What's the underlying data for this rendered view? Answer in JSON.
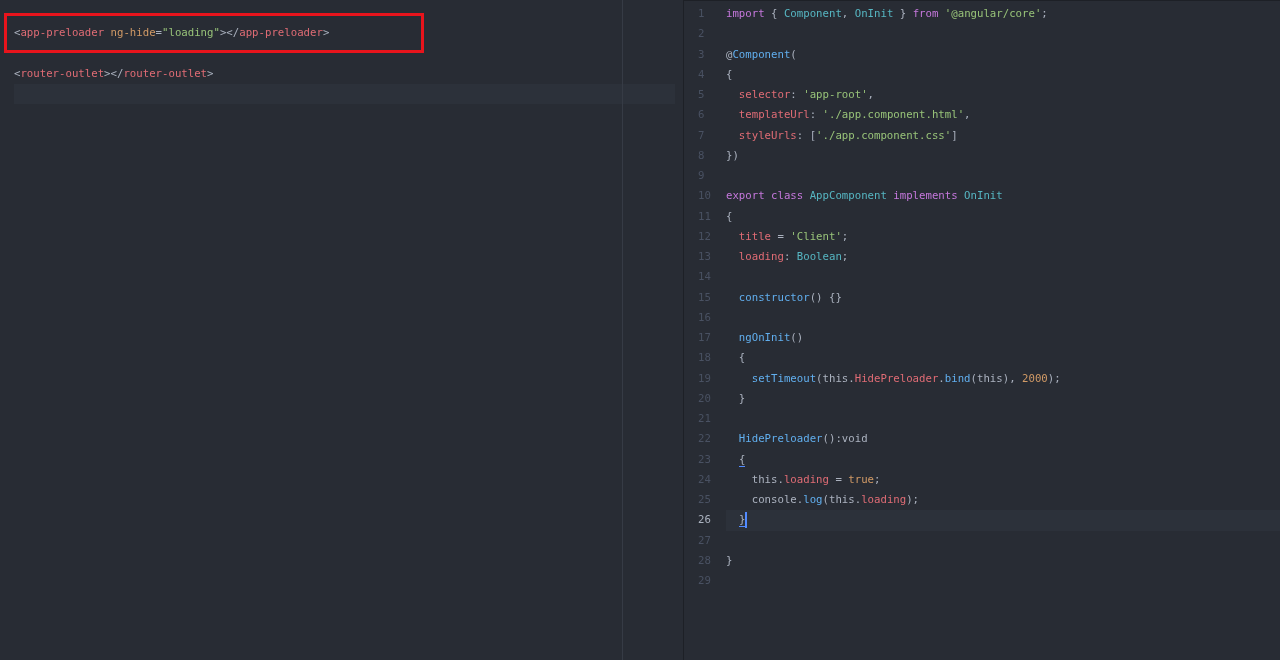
{
  "left_pane": {
    "lines": [
      {
        "boxed": true,
        "tokens": [
          {
            "text": "<",
            "kind": "punct"
          },
          {
            "text": "app-preloader",
            "kind": "tag"
          },
          {
            "text": " ng-hide",
            "kind": "attr"
          },
          {
            "text": "=",
            "kind": "punct"
          },
          {
            "text": "\"loading\"",
            "kind": "string"
          },
          {
            "text": "></",
            "kind": "punct"
          },
          {
            "text": "app-preloader",
            "kind": "tag"
          },
          {
            "text": ">",
            "kind": "punct"
          }
        ]
      },
      {
        "tokens": [
          {
            "text": "<",
            "kind": "punct"
          },
          {
            "text": "router-outlet",
            "kind": "tag"
          },
          {
            "text": "></",
            "kind": "punct"
          },
          {
            "text": "router-outlet",
            "kind": "tag"
          },
          {
            "text": ">",
            "kind": "punct"
          }
        ]
      },
      {
        "current": true
      }
    ]
  },
  "right_pane": {
    "lines": [
      {
        "number": "1",
        "tokens": [
          {
            "text": "import",
            "kind": "keyword"
          },
          {
            "text": " { ",
            "kind": "punct"
          },
          {
            "text": "Component",
            "kind": "type"
          },
          {
            "text": ", ",
            "kind": "punct"
          },
          {
            "text": "OnInit",
            "kind": "type"
          },
          {
            "text": " } ",
            "kind": "punct"
          },
          {
            "text": "from",
            "kind": "keyword"
          },
          {
            "text": " '@angular/core'",
            "kind": "string"
          },
          {
            "text": ";",
            "kind": "punct"
          }
        ]
      },
      {
        "number": "2"
      },
      {
        "number": "3",
        "tokens": [
          {
            "text": "@",
            "kind": "punct"
          },
          {
            "text": "Component",
            "kind": "func"
          },
          {
            "text": "(",
            "kind": "punct"
          }
        ]
      },
      {
        "number": "4",
        "tokens": [
          {
            "text": "{",
            "kind": "punct"
          }
        ]
      },
      {
        "number": "5",
        "tokens": [
          {
            "text": "  selector",
            "kind": "property"
          },
          {
            "text": ": ",
            "kind": "punct"
          },
          {
            "text": "'app-root'",
            "kind": "string"
          },
          {
            "text": ",",
            "kind": "punct"
          }
        ]
      },
      {
        "number": "6",
        "tokens": [
          {
            "text": "  templateUrl",
            "kind": "property"
          },
          {
            "text": ": ",
            "kind": "punct"
          },
          {
            "text": "'./app.component.html'",
            "kind": "string"
          },
          {
            "text": ",",
            "kind": "punct"
          }
        ]
      },
      {
        "number": "7",
        "tokens": [
          {
            "text": "  styleUrls",
            "kind": "property"
          },
          {
            "text": ": [",
            "kind": "punct"
          },
          {
            "text": "'./app.component.css'",
            "kind": "string"
          },
          {
            "text": "]",
            "kind": "punct"
          }
        ]
      },
      {
        "number": "8",
        "tokens": [
          {
            "text": "})",
            "kind": "punct"
          }
        ]
      },
      {
        "number": "9"
      },
      {
        "number": "10",
        "tokens": [
          {
            "text": "export",
            "kind": "keyword"
          },
          {
            "text": " class",
            "kind": "keyword"
          },
          {
            "text": " AppComponent",
            "kind": "type"
          },
          {
            "text": " implements",
            "kind": "keyword"
          },
          {
            "text": " OnInit",
            "kind": "type"
          }
        ]
      },
      {
        "number": "11",
        "tokens": [
          {
            "text": "{",
            "kind": "punct"
          }
        ]
      },
      {
        "number": "12",
        "tokens": [
          {
            "text": "  title",
            "kind": "property"
          },
          {
            "text": " = ",
            "kind": "punct"
          },
          {
            "text": "'Client'",
            "kind": "string"
          },
          {
            "text": ";",
            "kind": "punct"
          }
        ]
      },
      {
        "number": "13",
        "tokens": [
          {
            "text": "  loading",
            "kind": "property"
          },
          {
            "text": ": ",
            "kind": "punct"
          },
          {
            "text": "Boolean",
            "kind": "type"
          },
          {
            "text": ";",
            "kind": "punct"
          }
        ]
      },
      {
        "number": "14"
      },
      {
        "number": "15",
        "tokens": [
          {
            "text": "  constructor",
            "kind": "func"
          },
          {
            "text": "() {}",
            "kind": "punct"
          }
        ]
      },
      {
        "number": "16"
      },
      {
        "number": "17",
        "tokens": [
          {
            "text": "  ngOnInit",
            "kind": "func"
          },
          {
            "text": "()",
            "kind": "punct"
          }
        ]
      },
      {
        "number": "18",
        "tokens": [
          {
            "text": "  {",
            "kind": "punct"
          }
        ]
      },
      {
        "number": "19",
        "tokens": [
          {
            "text": "    setTimeout",
            "kind": "func"
          },
          {
            "text": "(this.",
            "kind": "punct"
          },
          {
            "text": "HidePreloader",
            "kind": "property"
          },
          {
            "text": ".",
            "kind": "punct"
          },
          {
            "text": "bind",
            "kind": "func"
          },
          {
            "text": "(this), ",
            "kind": "punct"
          },
          {
            "text": "2000",
            "kind": "number"
          },
          {
            "text": ");",
            "kind": "punct"
          }
        ]
      },
      {
        "number": "20",
        "tokens": [
          {
            "text": "  }",
            "kind": "punct"
          }
        ]
      },
      {
        "number": "21"
      },
      {
        "number": "22",
        "tokens": [
          {
            "text": "  HidePreloader",
            "kind": "func"
          },
          {
            "text": "():void",
            "kind": "punct"
          }
        ]
      },
      {
        "number": "23",
        "tokens": [
          {
            "text": "  {",
            "kind": "match"
          }
        ]
      },
      {
        "number": "24",
        "tokens": [
          {
            "text": "    this.",
            "kind": "punct"
          },
          {
            "text": "loading",
            "kind": "property"
          },
          {
            "text": " = ",
            "kind": "punct"
          },
          {
            "text": "true",
            "kind": "number"
          },
          {
            "text": ";",
            "kind": "punct"
          }
        ]
      },
      {
        "number": "25",
        "tokens": [
          {
            "text": "    console.",
            "kind": "punct"
          },
          {
            "text": "log",
            "kind": "func"
          },
          {
            "text": "(this.",
            "kind": "punct"
          },
          {
            "text": "loading",
            "kind": "property"
          },
          {
            "text": ");",
            "kind": "punct"
          }
        ]
      },
      {
        "number": "26",
        "current": true,
        "cursor": true,
        "tokens": [
          {
            "text": "  }",
            "kind": "match"
          }
        ]
      },
      {
        "number": "27"
      },
      {
        "number": "28",
        "tokens": [
          {
            "text": "}",
            "kind": "punct"
          }
        ]
      },
      {
        "number": "29"
      }
    ]
  }
}
